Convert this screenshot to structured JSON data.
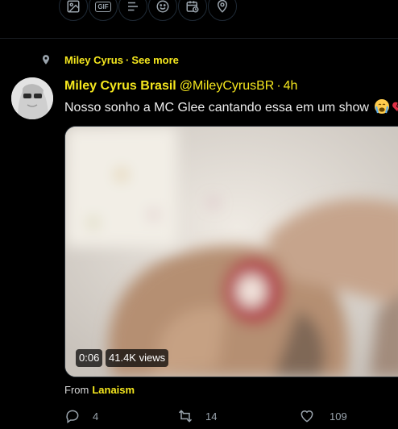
{
  "composer": {
    "tools": [
      {
        "name": "image-icon"
      },
      {
        "name": "gif-icon",
        "label": "GIF"
      },
      {
        "name": "poll-icon"
      },
      {
        "name": "emoji-icon"
      },
      {
        "name": "schedule-icon"
      },
      {
        "name": "location-icon"
      }
    ]
  },
  "context": {
    "icon": "location-pin-icon",
    "author": "Miley Cyrus",
    "separator": "·",
    "link": "See more"
  },
  "tweet": {
    "author_name": "Miley Cyrus Brasil",
    "handle": "@MileyCyrusBR",
    "separator": "·",
    "time": "4h",
    "text": "Nosso sonho a MC Glee cantando essa em um show",
    "media": {
      "duration": "0:06",
      "views": "41.4K views"
    },
    "from_label": "From",
    "from_source": "Lanaism",
    "actions": {
      "reply_count": "4",
      "retweet_count": "14",
      "like_count": "109"
    }
  },
  "colors": {
    "background": "#000000",
    "accent": "#f5e71e",
    "text": "#ececec",
    "muted": "#9aa4ad"
  }
}
